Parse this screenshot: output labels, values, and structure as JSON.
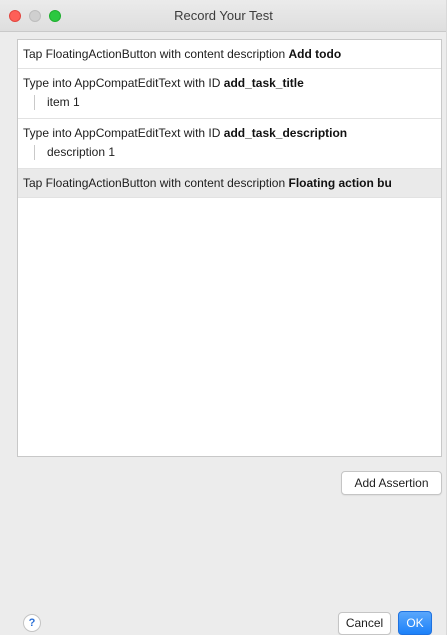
{
  "window": {
    "title": "Record Your Test"
  },
  "steps": [
    {
      "text": "Tap FloatingActionButton with content description ",
      "bold": "Add todo",
      "detail": ""
    },
    {
      "text": "Type into AppCompatEditText with ID ",
      "bold": "add_task_title",
      "detail": "item 1"
    },
    {
      "text": "Type into AppCompatEditText with ID ",
      "bold": "add_task_description",
      "detail": "description 1"
    },
    {
      "text": "Tap FloatingActionButton with content description ",
      "bold": "Floating action bu",
      "detail": ""
    }
  ],
  "buttons": {
    "add_assertion": "Add Assertion",
    "cancel": "Cancel",
    "ok": "OK",
    "help": "?"
  },
  "colors": {
    "close": "#fe5f57",
    "minimize": "#cfcfcf",
    "zoom": "#2bc840",
    "ok_button": "#1c81f9",
    "selected_row": "#eaeaea"
  },
  "icons": {
    "close": "close-window-icon",
    "minimize": "minimize-window-icon",
    "zoom": "zoom-window-icon",
    "help": "help-icon"
  }
}
